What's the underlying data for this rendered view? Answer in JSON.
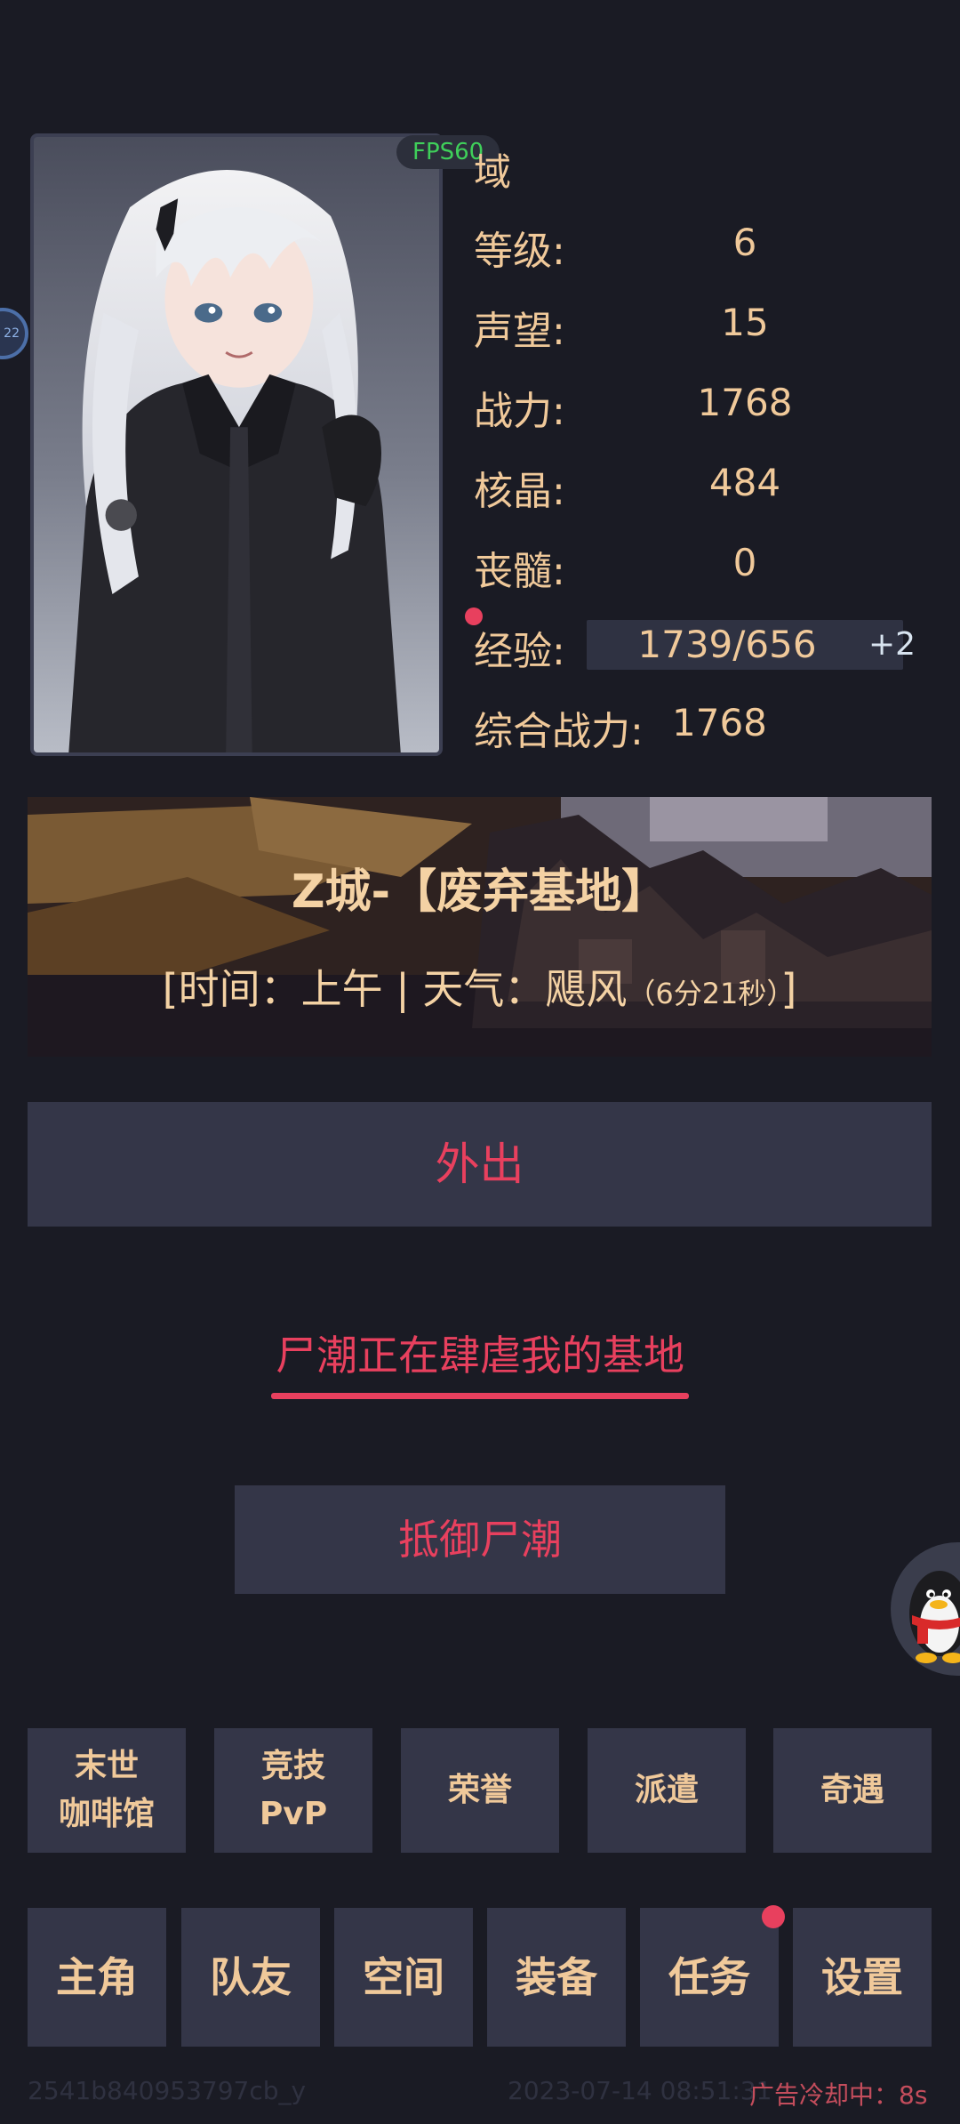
{
  "header": {
    "fps": "FPS60",
    "title_fragment": "域",
    "side_badge": "22"
  },
  "stats": {
    "level_label": "等级:",
    "level_value": "6",
    "prestige_label": "声望:",
    "prestige_value": "15",
    "power_label": "战力:",
    "power_value": "1768",
    "crystal_label": "核晶:",
    "crystal_value": "484",
    "marrow_label": "丧髓:",
    "marrow_value": "0",
    "exp_label": "经验:",
    "exp_value": "1739/656",
    "exp_plus": "+2",
    "total_power_label": "综合战力:",
    "total_power_value": "1768"
  },
  "location": {
    "title": "Z城-【废弃基地】",
    "info_prefix": "[时间：上午 | 天气：飓风",
    "info_timer": "（6分21秒）",
    "info_suffix": "]"
  },
  "actions": {
    "go_out": "外出",
    "alert": "尸潮正在肆虐我的基地",
    "defend": "抵御尸潮"
  },
  "menu": {
    "items": [
      {
        "line1": "末世",
        "line2": "咖啡馆"
      },
      {
        "line1": "竞技",
        "line2": "PvP"
      },
      {
        "line1": "荣誉",
        "line2": ""
      },
      {
        "line1": "派遣",
        "line2": ""
      },
      {
        "line1": "奇遇",
        "line2": ""
      }
    ]
  },
  "nav": {
    "items": [
      "主角",
      "队友",
      "空间",
      "装备",
      "任务",
      "设置"
    ]
  },
  "footer": {
    "id": "2541b840953797cb_y",
    "timestamp": "2023-07-14 08:51:31",
    "ad_cooldown": "广告冷却中：8s"
  },
  "colors": {
    "background": "#1a1b24",
    "panel": "#343648",
    "gold_text": "#f0c99a",
    "accent_red": "#e8405e",
    "fps_green": "#3fcf5a"
  }
}
